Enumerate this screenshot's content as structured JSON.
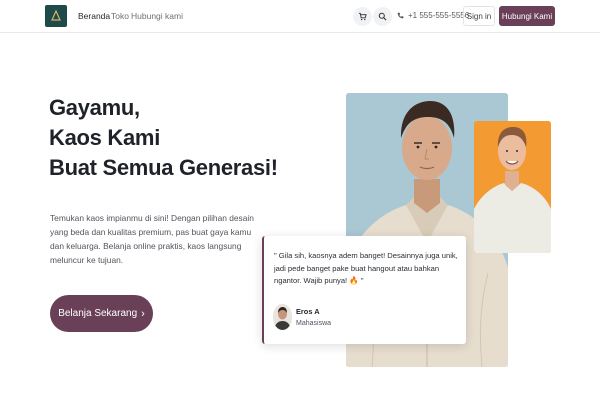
{
  "nav": {
    "links": [
      "Beranda",
      "Toko",
      "Hubungi kami"
    ],
    "active_index": 0,
    "phone": "+1 555-555-5556",
    "signin_label": "Sign in",
    "cta_label": "Hubungi Kami",
    "icons": [
      "cart-icon",
      "search-icon",
      "phone-icon"
    ]
  },
  "hero": {
    "title_lines": [
      "Gayamu,",
      "Kaos Kami",
      "Buat Semua Generasi!"
    ],
    "description": "Temukan kaos impianmu di sini! Dengan pilihan desain yang beda dan kualitas premium, pas buat gaya kamu dan keluarga. Belanja online praktis, kaos langsung meluncur ke tujuan.",
    "button_label": "Belanja Sekarang",
    "button_icon": "chevron-right-icon"
  },
  "testimonial": {
    "quote": "\" Gila sih, kaosnya adem banget! Desainnya juga unik, jadi pede banget pake buat hangout atau bahkan ngantor. Wajib punya! 🔥 \"",
    "author_name": "Eros A",
    "author_role": "Mahasiswa"
  },
  "colors": {
    "primary": "#6a4059",
    "logo_bg": "#1f4a4a",
    "photo_bg_blue": "#a7c6d3",
    "photo_bg_orange": "#f39a32"
  }
}
